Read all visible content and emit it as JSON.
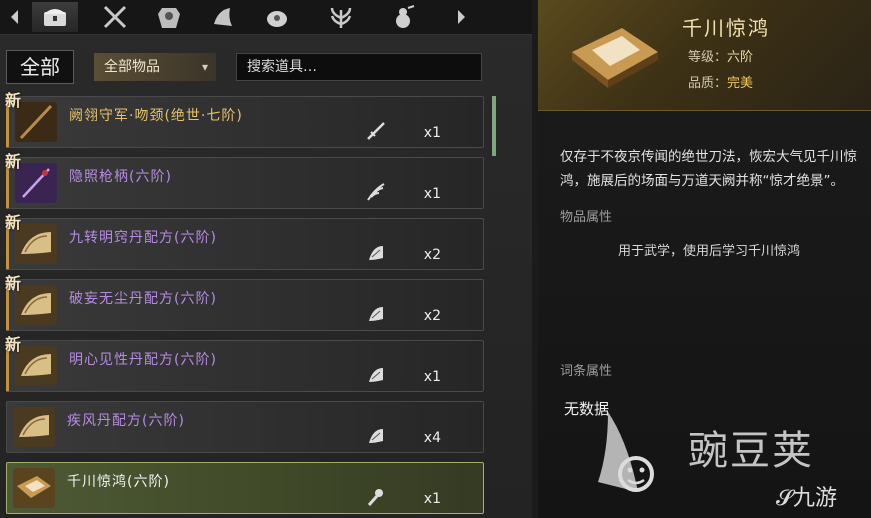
{
  "tabs": [
    {
      "icon": "chest-icon",
      "active": true
    },
    {
      "icon": "crossed-swords-icon"
    },
    {
      "icon": "armor-icon"
    },
    {
      "icon": "scroll-icon"
    },
    {
      "icon": "pot-icon"
    },
    {
      "icon": "herb-icon"
    },
    {
      "icon": "gourd-icon"
    }
  ],
  "filter": {
    "all_label": "全部",
    "category_label": "全部物品",
    "search_placeholder": "搜索道具…"
  },
  "new_tag": "新",
  "items": [
    {
      "name": "阙翎守军·吻颈(绝世·七阶)",
      "quality": "gold",
      "qty": "x1",
      "is_new": true,
      "type": "sword-icon"
    },
    {
      "name": "隐照枪柄(六阶)",
      "quality": "purple",
      "qty": "x1",
      "is_new": true,
      "type": "feather-icon"
    },
    {
      "name": "九转明窍丹配方(六阶)",
      "quality": "purple",
      "qty": "x2",
      "is_new": true,
      "type": "recipe-scroll-icon"
    },
    {
      "name": "破妄无尘丹配方(六阶)",
      "quality": "purple",
      "qty": "x2",
      "is_new": true,
      "type": "recipe-scroll-icon"
    },
    {
      "name": "明心见性丹配方(六阶)",
      "quality": "purple",
      "qty": "x1",
      "is_new": true,
      "type": "recipe-scroll-icon"
    },
    {
      "name": "疾风丹配方(六阶)",
      "quality": "purple",
      "qty": "x4",
      "is_new": false,
      "type": "recipe-scroll-icon"
    },
    {
      "name": "千川惊鸿(六阶)",
      "quality": "white",
      "qty": "x1",
      "is_new": false,
      "type": "skill-scroll-icon",
      "selected": true
    }
  ],
  "detail": {
    "title": "千川惊鸿",
    "level_label": "等级：",
    "level_value": "六阶",
    "quality_label": "品质：",
    "quality_value": "完美",
    "description": "仅存于不夜京传闻的绝世刀法，恢宏大气见千川惊鸿，施展后的场面与万道天阙并称“惊才绝景”。",
    "item_attr_title": "物品属性",
    "item_attr_text": "用于武学，使用后学习千川惊鸿",
    "entry_attr_title": "词条属性",
    "entry_attr_value": "无数据",
    "watermark_text": "豌豆荚",
    "watermark_sub": "九游"
  },
  "colors": {
    "gold": "#e6c36a",
    "purple": "#b58be2",
    "selected": "#a3b06a"
  }
}
